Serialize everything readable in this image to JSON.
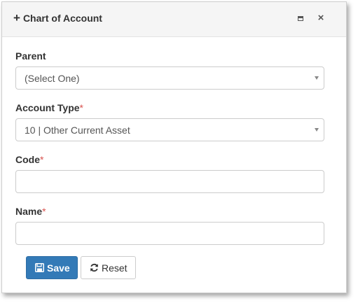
{
  "dialog": {
    "title": "Chart of Account",
    "title_icon": "plus-icon",
    "maximize_icon": "maximize-icon",
    "close_icon": "close-icon"
  },
  "form": {
    "parent": {
      "label": "Parent",
      "selected": "(Select One)"
    },
    "account_type": {
      "label": "Account Type",
      "required_mark": "*",
      "selected": "10 | Other Current Asset"
    },
    "code": {
      "label": "Code",
      "required_mark": "*",
      "value": ""
    },
    "name": {
      "label": "Name",
      "required_mark": "*",
      "value": ""
    }
  },
  "buttons": {
    "save_label": "Save",
    "save_icon": "floppy-disk-icon",
    "reset_label": "Reset",
    "reset_icon": "refresh-icon"
  },
  "colors": {
    "primary": "#337ab7",
    "required": "#d9534f",
    "header_bg": "#f5f5f5"
  }
}
